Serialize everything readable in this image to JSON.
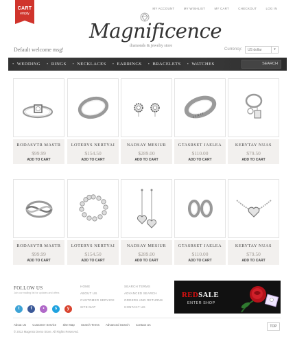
{
  "header": {
    "cart_label": "CART",
    "cart_status": "empty",
    "top_links": [
      "MY ACCOUNT",
      "MY WISHLIST",
      "MY CART",
      "CHECKOUT",
      "LOG IN"
    ],
    "logo_name": "Magnificence",
    "logo_tagline": "diamonds & jewelry store",
    "welcome": "Default welcome msg!",
    "currency_label": "Currency:",
    "currency_value": "US dollar"
  },
  "nav": {
    "items": [
      "WEDDING",
      "RINGS",
      "NECKLACES",
      "EARRINGS",
      "BRACELETS",
      "WATCHES"
    ],
    "search_label": "SEARCH"
  },
  "products": [
    {
      "name": "RODASYTR MASTR",
      "price": "$99.99",
      "cta": "ADD TO CART",
      "icon": "square-solitaire-ring"
    },
    {
      "name": "LOTERYS NERTYAI",
      "price": "$154.50",
      "cta": "ADD TO CART",
      "icon": "band-ring"
    },
    {
      "name": "NADSAY MESIUR",
      "price": "$289.00",
      "cta": "ADD TO CART",
      "icon": "stud-earrings"
    },
    {
      "name": "GTASRSET JAELEA",
      "price": "$110.00",
      "cta": "ADD TO CART",
      "icon": "engraved-ring"
    },
    {
      "name": "KERYTAY NUAS",
      "price": "$79.50",
      "cta": "ADD TO CART",
      "icon": "charm-ring"
    },
    {
      "name": "RODASYTR MASTR",
      "price": "$99.99",
      "cta": "ADD TO CART",
      "icon": "crossover-ring"
    },
    {
      "name": "LOTERYS NERTYAI",
      "price": "$154.50",
      "cta": "ADD TO CART",
      "icon": "bead-bracelet"
    },
    {
      "name": "NADSAY MESIUR",
      "price": "$289.00",
      "cta": "ADD TO CART",
      "icon": "heart-drop-earrings"
    },
    {
      "name": "GTASRSET JAELEA",
      "price": "$110.00",
      "cta": "ADD TO CART",
      "icon": "hoop-earrings"
    },
    {
      "name": "KERYTAY NUAS",
      "price": "$79.50",
      "cta": "ADD TO CART",
      "icon": "heart-necklace"
    }
  ],
  "footer": {
    "follow_title": "FOLLOW US",
    "follow_sub": "Join our mailing list for updates and offers",
    "social": [
      {
        "glyph": "t",
        "color": "#3da3d6",
        "icon": "twitter-icon"
      },
      {
        "glyph": "f",
        "color": "#3b5998",
        "icon": "facebook-icon"
      },
      {
        "glyph": "•",
        "color": "#b069c8",
        "icon": "flickr-icon"
      },
      {
        "glyph": "s",
        "color": "#1fa2df",
        "icon": "skype-icon"
      },
      {
        "glyph": "y",
        "color": "#d9442f",
        "icon": "youtube-icon"
      }
    ],
    "col1": [
      "HOME",
      "ABOUT US",
      "CUSTOMER SERVICE",
      "SITE MAP"
    ],
    "col2": [
      "SEARCH TERMS",
      "ADVANCED SEARCH",
      "ORDERS AND RETURNS",
      "CONTACT US"
    ],
    "banner_red": "RED",
    "banner_white": "SALE",
    "banner_sub": "ENTER SHOP",
    "bottom_links": [
      "About Us",
      "Customer Service",
      "Site Map",
      "Search Terms",
      "Advanced Search",
      "Contact Us"
    ],
    "copyright": "© 2012 Magento Demo Store. All Rights Reserved.",
    "top_button": "TOP"
  },
  "colors": {
    "accent_red": "#d0342c",
    "nav_bg": "#2d2d2d",
    "info_bg": "#f2f0ee"
  }
}
